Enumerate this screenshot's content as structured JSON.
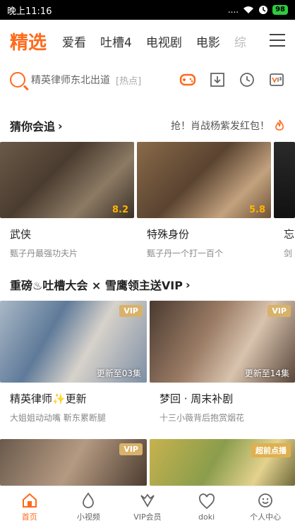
{
  "status": {
    "time": "晚上11:16",
    "signal": "....",
    "battery": "98"
  },
  "tabs": [
    {
      "label": "精选"
    },
    {
      "label": "爱看"
    },
    {
      "label": "吐槽4"
    },
    {
      "label": "电视剧"
    },
    {
      "label": "电影"
    },
    {
      "label": "综"
    }
  ],
  "search": {
    "query": "精英律师东北出道",
    "hot": "[热点]"
  },
  "section1": {
    "title": "猜你会追",
    "promo": "抢！肖战杨紫发红包！"
  },
  "row1": [
    {
      "name": "武侠",
      "desc": "甄子丹最强功夫片",
      "rating": "8.2"
    },
    {
      "name": "特殊身份",
      "desc": "甄子丹一个打一百个",
      "rating": "5.8"
    },
    {
      "name": "忘",
      "desc": "剑",
      "rating": ""
    }
  ],
  "section2": {
    "title": "重磅♨吐槽大会 × 雪鹰领主送VIP"
  },
  "row2": [
    {
      "name": "精英律师✨更新",
      "desc": "大姐姐动动嘴 靳东累断腿",
      "badge": "VIP",
      "ep": "更新至03集"
    },
    {
      "name": "梦回 · 周末补剧",
      "desc": "十三小薇背后抱赏烟花",
      "badge": "VIP",
      "ep": "更新至14集"
    }
  ],
  "row3": [
    {
      "badge": "VIP"
    },
    {
      "badge": "超前点播"
    }
  ],
  "bottom": [
    {
      "label": "首页"
    },
    {
      "label": "小视频"
    },
    {
      "label": "VIP会员"
    },
    {
      "label": "doki"
    },
    {
      "label": "个人中心"
    }
  ],
  "colors": {
    "accent": "#ff6a1a",
    "vip": "#d8b26a",
    "rating": "#ffb400"
  }
}
